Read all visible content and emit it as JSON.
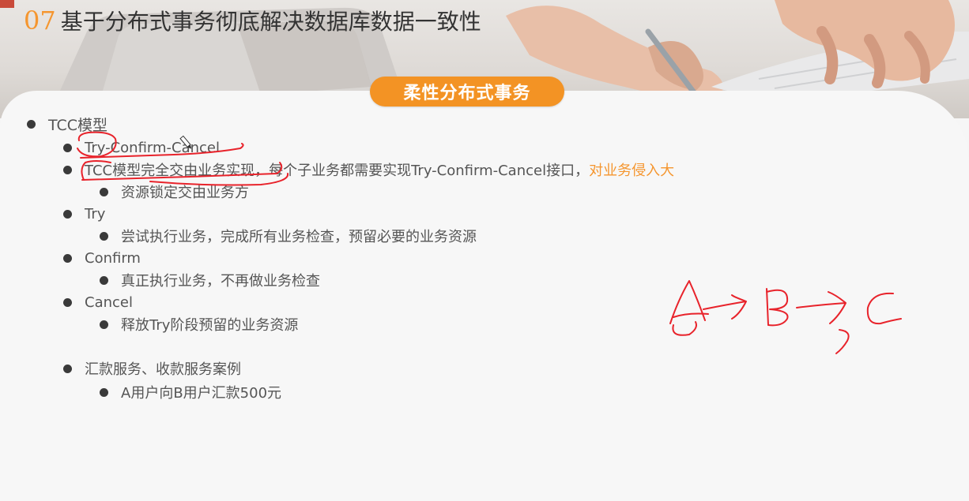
{
  "header": {
    "number": "07",
    "title": "基于分布式事务彻底解决数据库数据一致性"
  },
  "pill_label": "柔性分布式事务",
  "bullets": {
    "tcc_model": "TCC模型",
    "try_confirm_cancel": "Try-Confirm-Cancel",
    "tcc_impl_main": "TCC模型完全交由业务实现，每个子业务都需要实现Try-Confirm-Cancel接口，",
    "tcc_impl_accent": "对业务侵入大",
    "resource_lock": "资源锁定交由业务方",
    "try": "Try",
    "try_desc": "尝试执行业务，完成所有业务检查，预留必要的业务资源",
    "confirm": "Confirm",
    "confirm_desc": "真正执行业务，不再做业务检查",
    "cancel": "Cancel",
    "cancel_desc": "释放Try阶段预留的业务资源",
    "case": "汇款服务、收款服务案例",
    "case_desc": "A用户向B用户汇款500元"
  },
  "colors": {
    "accent": "#f5962f",
    "pill": "#f39324",
    "annotation": "#e8232b"
  }
}
